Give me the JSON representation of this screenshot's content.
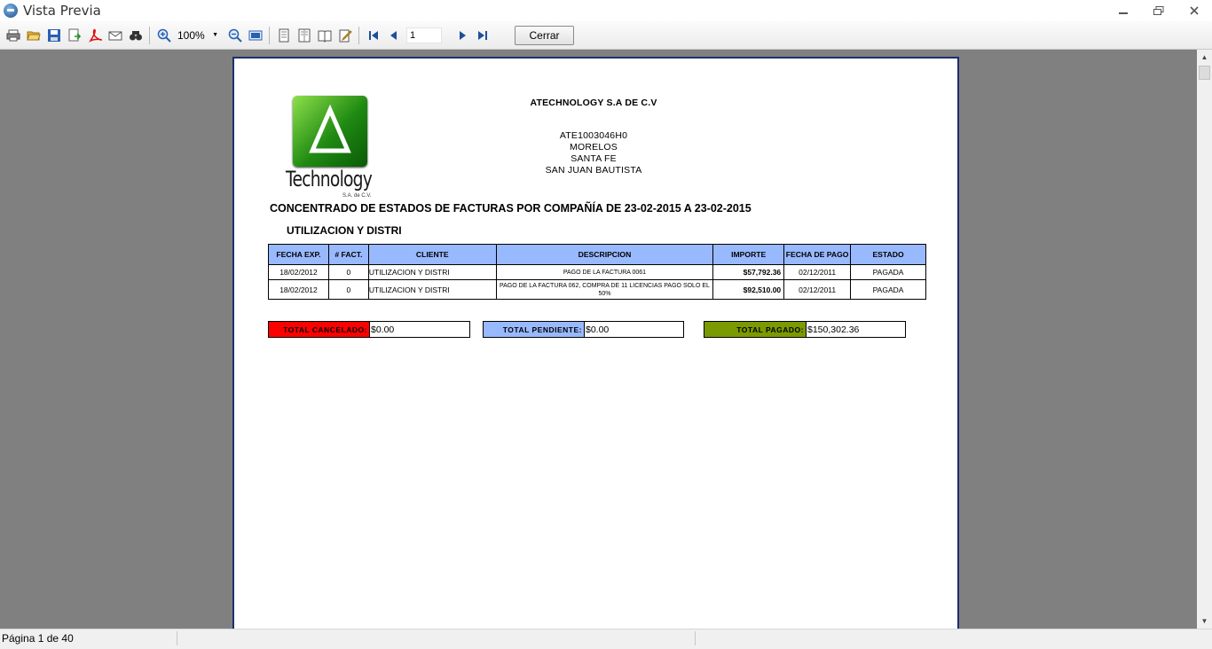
{
  "window": {
    "title": "Vista Previa"
  },
  "toolbar": {
    "zoom": "100%",
    "page_input": "1",
    "close_label": "Cerrar"
  },
  "report": {
    "company": "ATECHNOLOGY S.A DE C.V",
    "rfc": "ATE1003046H0",
    "address_lines": [
      "MORELOS",
      "SANTA FE",
      "SAN JUAN BAUTISTA"
    ],
    "logo_text": "Technology",
    "logo_subtext": "S.A. de C.V.",
    "title": "CONCENTRADO DE ESTADOS DE FACTURAS POR COMPAÑÍA DE 23-02-2015 A 23-02-2015",
    "subtitle": "UTILIZACION Y DISTRI",
    "table": {
      "headers": [
        "FECHA EXP.",
        "# FACT.",
        "CLIENTE",
        "DESCRIPCION",
        "IMPORTE",
        "FECHA DE PAGO",
        "ESTADO"
      ],
      "rows": [
        [
          "18/02/2012",
          "0",
          "UTILIZACION Y DISTRI",
          "PAGO DE LA FACTURA 0061",
          "$57,792.36",
          "02/12/2011",
          "PAGADA"
        ],
        [
          "18/02/2012",
          "0",
          "UTILIZACION Y DISTRI",
          "PAGO DE LA FACTURA 062, COMPRA DE 11 LICENCIAS PAGO SOLO EL 50%",
          "$92,510.00",
          "02/12/2011",
          "PAGADA"
        ]
      ]
    },
    "totals": {
      "cancelado_label": "TOTAL CANCELADO:",
      "cancelado_value": "$0.00",
      "cancelado_color": "#ff0000",
      "pendiente_label": "TOTAL PENDIENTE:",
      "pendiente_value": "$0.00",
      "pendiente_color": "#99b9ff",
      "pagado_label": "TOTAL PAGADO:",
      "pagado_value": "$150,302.36",
      "pagado_color": "#7a9a00"
    }
  },
  "status": {
    "text": "Página 1 de 40"
  }
}
